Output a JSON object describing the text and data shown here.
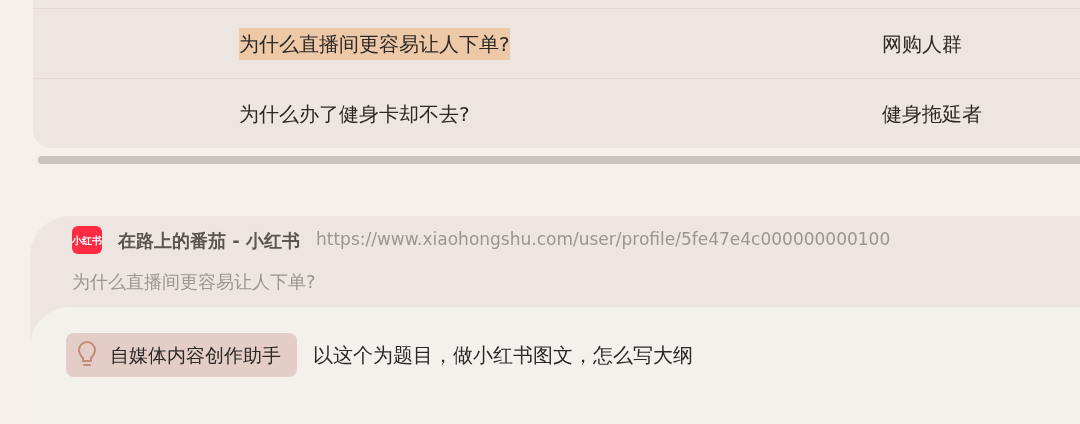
{
  "table": {
    "rows": [
      {
        "cells": [
          "为什么直播间更容易让人下单?",
          "网购人群"
        ],
        "selected": true
      },
      {
        "cells": [
          "为什么办了健身卡却不去?",
          "健身拖延者"
        ],
        "selected": false
      }
    ]
  },
  "source": {
    "site": "小红书",
    "title": "在路上的番茄 - 小红书",
    "url": "https://www.xiaohongshu.com/user/profile/5fe47e4c000000000100",
    "quote": "为什么直播间更容易让人下单?"
  },
  "prompt": {
    "assistant": "自媒体内容创作助手",
    "text": "以这个为题目，做小红书图文，怎么写大纲"
  }
}
